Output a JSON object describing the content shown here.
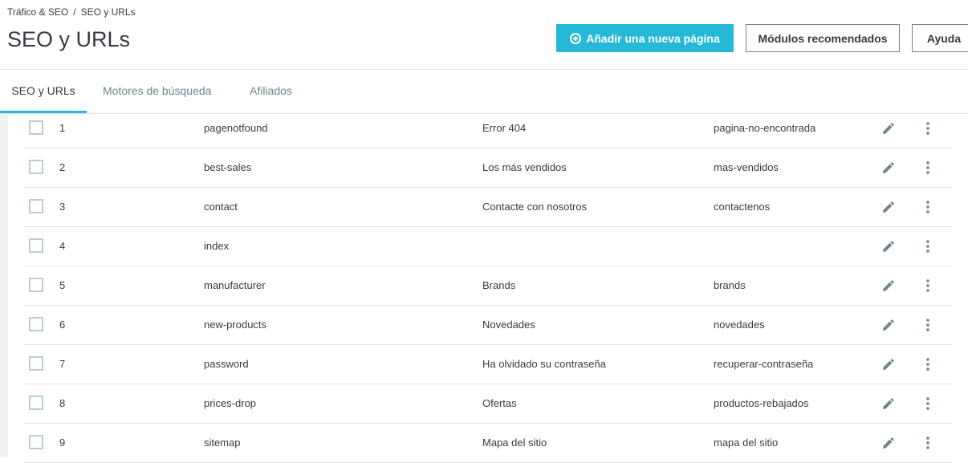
{
  "breadcrumb": {
    "parent": "Tráfico & SEO",
    "separator": "/",
    "current": "SEO y URLs"
  },
  "page_title": "SEO y URLs",
  "toolbar": {
    "add_label": "Añadir una nueva página",
    "modules_label": "Módulos recomendados",
    "help_label": "Ayuda"
  },
  "tabs": [
    {
      "label": "SEO y URLs",
      "active": true
    },
    {
      "label": "Motores de búsqueda",
      "active": false
    },
    {
      "label": "Afiliados",
      "active": false
    }
  ],
  "rows": [
    {
      "id": "1",
      "page": "pagenotfound",
      "title": "Error 404",
      "url": "pagina-no-encontrada"
    },
    {
      "id": "2",
      "page": "best-sales",
      "title": "Los más vendidos",
      "url": "mas-vendidos"
    },
    {
      "id": "3",
      "page": "contact",
      "title": "Contacte con nosotros",
      "url": "contactenos"
    },
    {
      "id": "4",
      "page": "index",
      "title": "",
      "url": ""
    },
    {
      "id": "5",
      "page": "manufacturer",
      "title": "Brands",
      "url": "brands"
    },
    {
      "id": "6",
      "page": "new-products",
      "title": "Novedades",
      "url": "novedades"
    },
    {
      "id": "7",
      "page": "password",
      "title": "Ha olvidado su contraseña",
      "url": "recuperar-contraseña"
    },
    {
      "id": "8",
      "page": "prices-drop",
      "title": "Ofertas",
      "url": "productos-rebajados"
    },
    {
      "id": "9",
      "page": "sitemap",
      "title": "Mapa del sitio",
      "url": "mapa del sitio"
    }
  ],
  "colors": {
    "accent": "#25b9d7",
    "text": "#363a41",
    "muted": "#6c868e",
    "border": "#dfe4e8"
  }
}
